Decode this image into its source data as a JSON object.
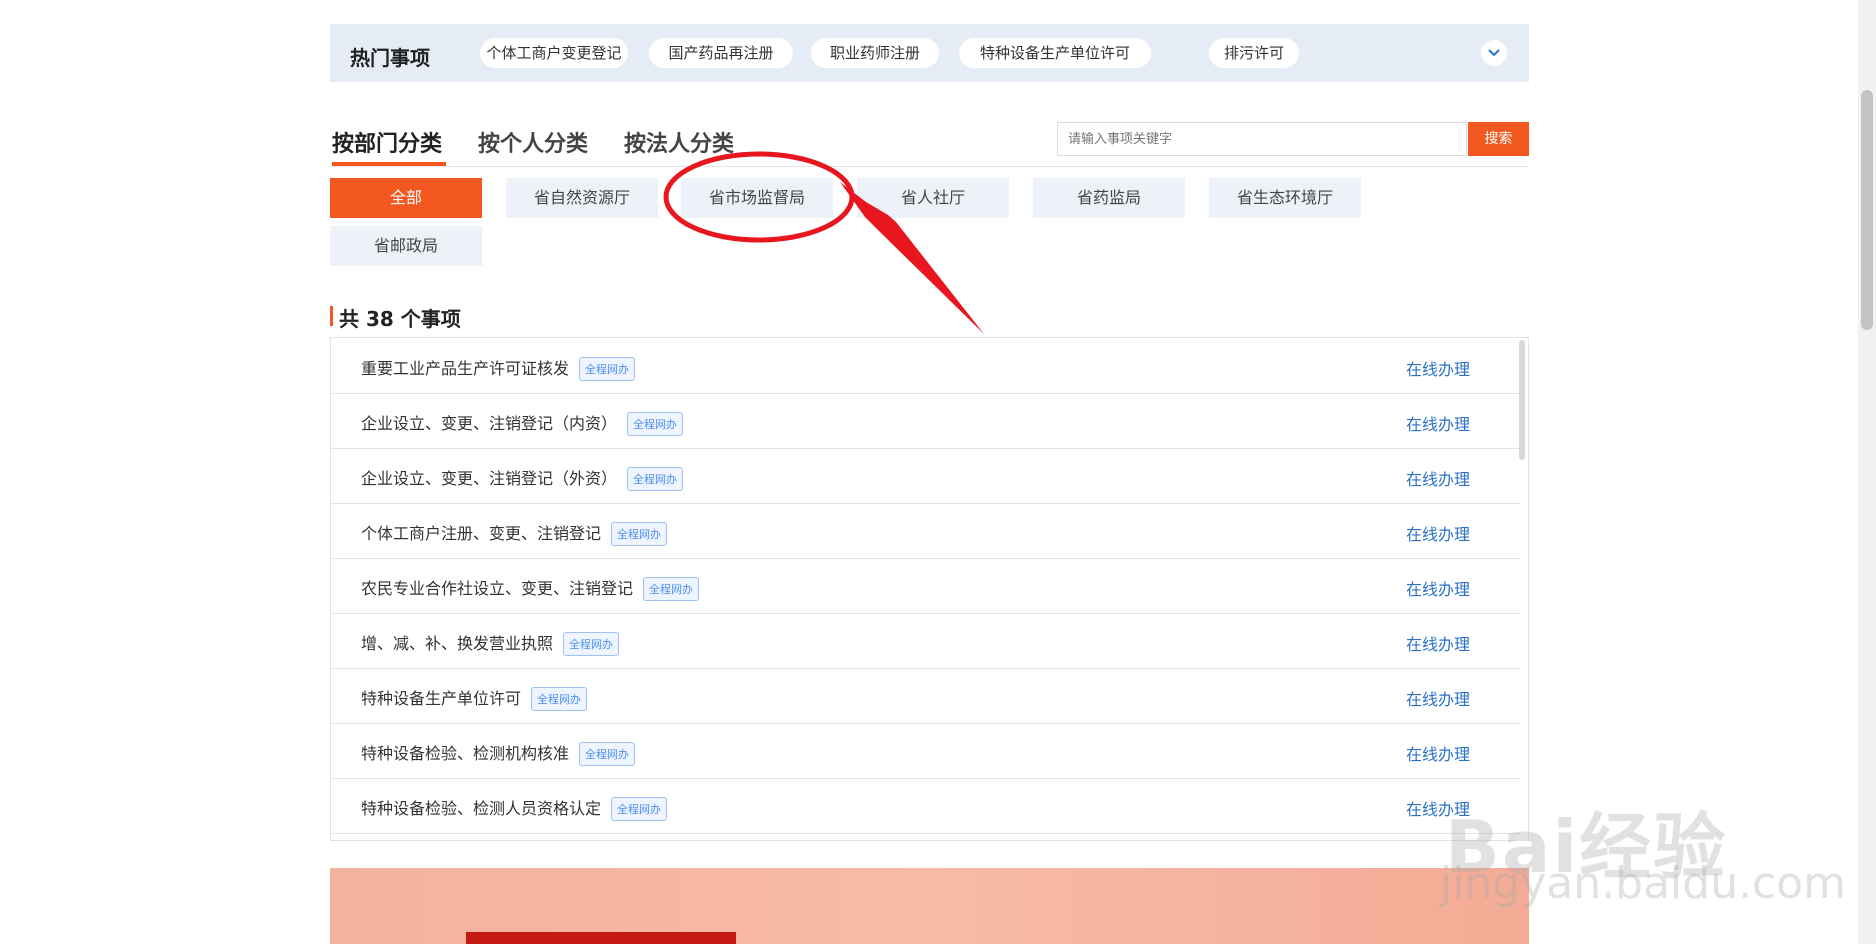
{
  "hot": {
    "title": "热门事项",
    "chips": [
      "个体工商户变更登记",
      "国产药品再注册",
      "职业药师注册",
      "特种设备生产单位许可",
      "排污许可"
    ]
  },
  "tabs": [
    "按部门分类",
    "按个人分类",
    "按法人分类"
  ],
  "search": {
    "placeholder": "请输入事项关键字",
    "button": "搜索"
  },
  "departments": [
    "全部",
    "省自然资源厅",
    "省市场监督局",
    "省人社厅",
    "省药监局",
    "省生态环境厅",
    "省邮政局"
  ],
  "count_label": "共 38 个事项",
  "badge_label": "全程网办",
  "action_label": "在线办理",
  "items": [
    "重要工业产品生产许可证核发",
    "企业设立、变更、注销登记（内资）",
    "企业设立、变更、注销登记（外资）",
    "个体工商户注册、变更、注销登记",
    "农民专业合作社设立、变更、注销登记",
    "增、减、补、换发营业执照",
    "特种设备生产单位许可",
    "特种设备检验、检测机构核准",
    "特种设备检验、检测人员资格认定"
  ],
  "watermark": {
    "main": "Bai经验",
    "sub": "jingyan.baidu.com"
  },
  "colors": {
    "accent": "#f2581f",
    "link": "#2a72c8",
    "annotation": "#e8161e"
  }
}
